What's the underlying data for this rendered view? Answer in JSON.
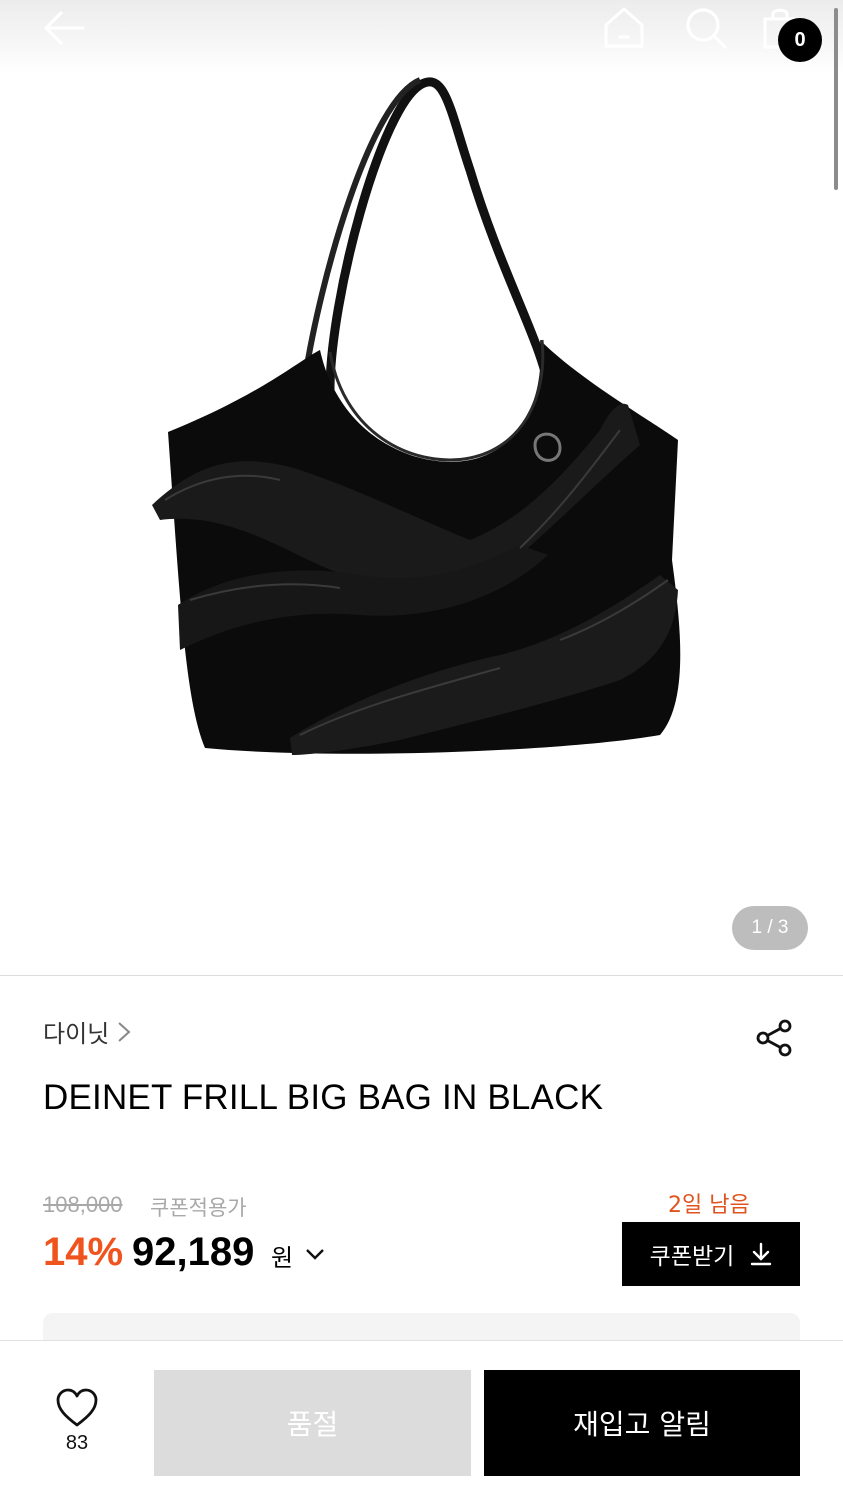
{
  "header": {
    "back_icon": "arrow-left-icon",
    "home_icon": "home-icon",
    "search_icon": "search-icon",
    "cart_icon": "shopping-bag-icon",
    "cart_count": "0"
  },
  "gallery": {
    "counter": "1 / 3"
  },
  "product": {
    "brand": "다이닛",
    "title": "DEINET FRILL BIG BAG IN BLACK",
    "original_price": "108,000",
    "coupon_price_label": "쿠폰적용가",
    "discount_rate": "14%",
    "sale_price": "92,189",
    "currency": "원"
  },
  "coupon": {
    "days_left": "2일 남음",
    "button_label": "쿠폰받기"
  },
  "bottom_bar": {
    "like_count": "83",
    "soldout_label": "품절",
    "restock_label": "재입고 알림"
  },
  "colors": {
    "accent": "#f0541e",
    "primary_button": "#000000",
    "disabled_button": "#dcdcdc"
  }
}
